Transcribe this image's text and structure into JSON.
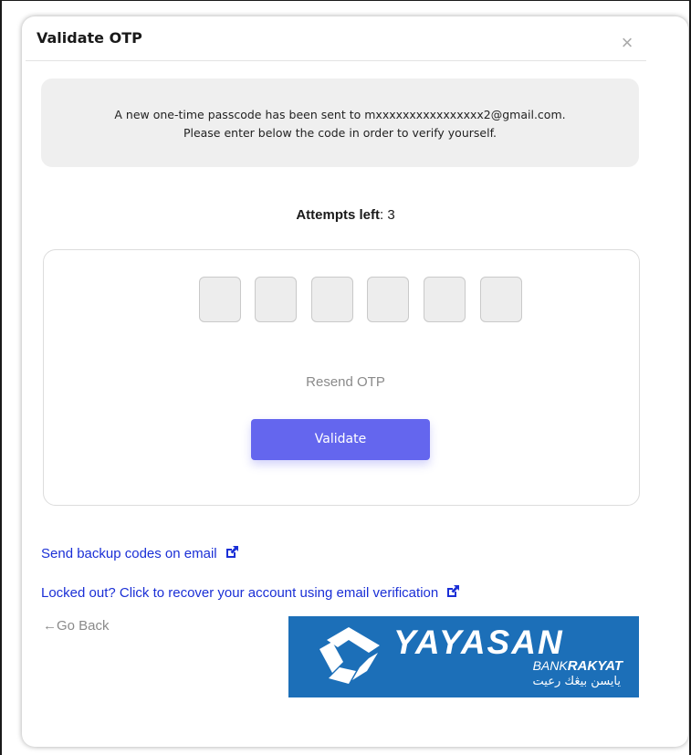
{
  "modal": {
    "title": "Validate OTP",
    "close_glyph": "×",
    "notice_line1": "A new one-time passcode has been sent to mxxxxxxxxxxxxxxxx2@gmail.com.",
    "notice_line2": "Please enter below the code in order to verify yourself."
  },
  "attempts": {
    "label": "Attempts left",
    "separator": ":",
    "value": "3"
  },
  "otp": {
    "digits": [
      "",
      "",
      "",
      "",
      "",
      ""
    ],
    "resend_label": "Resend OTP",
    "validate_label": "Validate"
  },
  "links": {
    "backup": "Send backup codes on email",
    "recover": "Locked out? Click to recover your account using email verification",
    "icon": "external-link-icon"
  },
  "go_back": {
    "arrow": "←",
    "label": "Go Back"
  },
  "logo": {
    "word": "YAYASAN",
    "bank_prefix": "BANK",
    "bank_bold": "RAKYAT",
    "jawi": "يايسن بيڠك رعيت"
  },
  "colors": {
    "accent": "#6466ee",
    "link": "#1a2fd6",
    "logo_bg": "#1c6fb8",
    "notice_bg": "#efefef"
  }
}
